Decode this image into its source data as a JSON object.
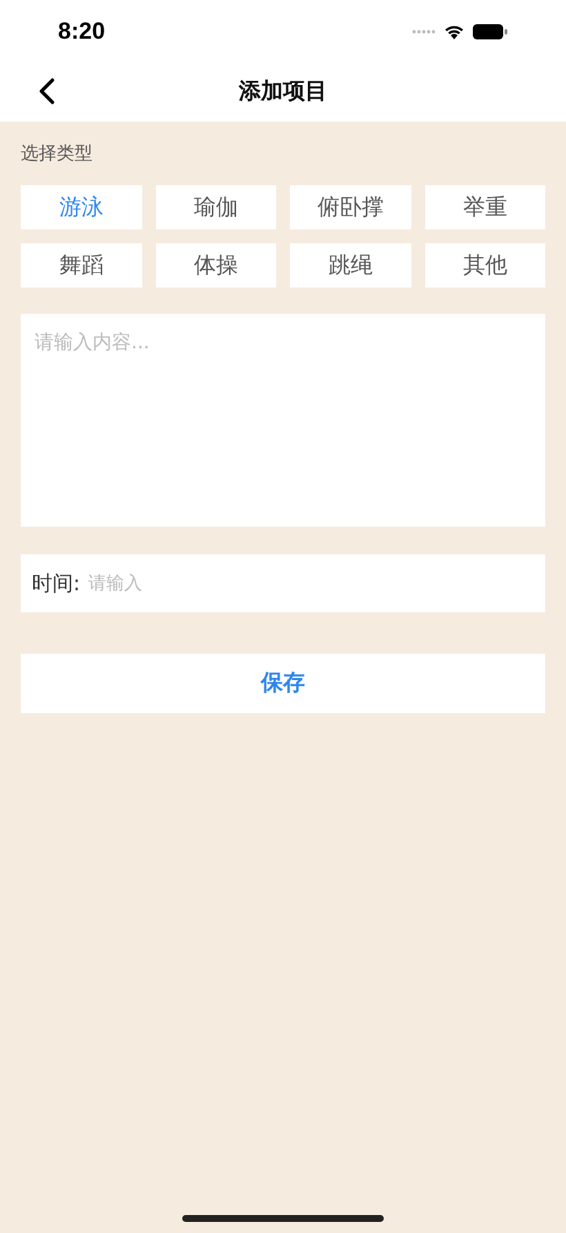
{
  "status_bar": {
    "time": "8:20"
  },
  "nav": {
    "title": "添加项目"
  },
  "type_section": {
    "label": "选择类型",
    "options": [
      {
        "label": "游泳",
        "selected": true
      },
      {
        "label": "瑜伽",
        "selected": false
      },
      {
        "label": "俯卧撑",
        "selected": false
      },
      {
        "label": "举重",
        "selected": false
      },
      {
        "label": "舞蹈",
        "selected": false
      },
      {
        "label": "体操",
        "selected": false
      },
      {
        "label": "跳绳",
        "selected": false
      },
      {
        "label": "其他",
        "selected": false
      }
    ]
  },
  "content": {
    "placeholder": "请输入内容..."
  },
  "time_field": {
    "label": "时间:",
    "placeholder": "请输入"
  },
  "save_button": "保存"
}
